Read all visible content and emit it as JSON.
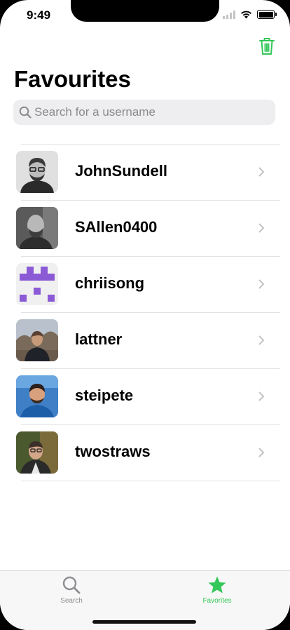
{
  "status": {
    "time": "9:49"
  },
  "header": {
    "title": "Favourites"
  },
  "search": {
    "placeholder": "Search for a username"
  },
  "favorites": [
    {
      "username": "JohnSundell"
    },
    {
      "username": "SAllen0400"
    },
    {
      "username": "chriisong"
    },
    {
      "username": "lattner"
    },
    {
      "username": "steipete"
    },
    {
      "username": "twostraws"
    }
  ],
  "tabs": [
    {
      "label": "Search",
      "icon": "search-icon",
      "selected": false
    },
    {
      "label": "Favorites",
      "icon": "star-icon",
      "selected": true
    }
  ],
  "colors": {
    "accent": "#34c759",
    "inactive": "#8e8e93",
    "identicon": "#8b5bd6"
  }
}
